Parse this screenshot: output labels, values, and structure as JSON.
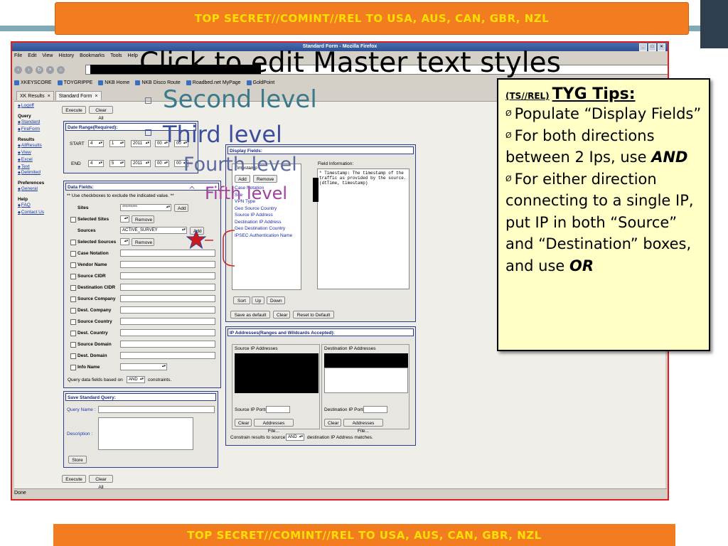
{
  "classification": "TOP SECRET//COMINT//REL TO USA, AUS, CAN, GBR, NZL",
  "colors": {
    "banner_bg": "#f47c20",
    "banner_text": "#ffe000",
    "tips_bg": "#ffffc6",
    "title_teal": "#3a7a8a",
    "accent_purple": "#a040a0"
  },
  "slide": {
    "title": "Click to edit Master text styles",
    "level2": "Second level",
    "level3": "Third level",
    "level4": "Fourth level",
    "level5": "Fifth level"
  },
  "browser": {
    "title": "Standard Form - Mozilla Firefox",
    "menu": [
      "File",
      "Edit",
      "View",
      "History",
      "Bookmarks",
      "Tools",
      "Help"
    ],
    "bookmarks": [
      "XKEYSCORE",
      "TOYGRIPPE",
      "NKB Home",
      "NKB Disco Route",
      "Roadbed.net MyPage",
      "GoldPoint"
    ],
    "tabs": [
      "XK Results",
      "Standard Form"
    ],
    "status": "Done"
  },
  "sidebar": {
    "logoff": "Logoff",
    "query_head": "Query",
    "query_items": [
      "Standard",
      "FireForm"
    ],
    "results_head": "Results",
    "results_items": [
      "AllResults",
      "View",
      "Excel",
      "Text",
      "Delimited"
    ],
    "prefs_head": "Preferences",
    "prefs_items": [
      "General"
    ],
    "help_head": "Help",
    "help_items": [
      "FAQ",
      "Contact Us"
    ]
  },
  "form": {
    "execute": "Execute",
    "clear_all": "Clear All",
    "date_range": {
      "title": "Date Range(Required):",
      "start_label": "START",
      "start": [
        "4",
        "1",
        "2011",
        "00",
        "00"
      ],
      "end_label": "END",
      "end": [
        "4",
        "5",
        "2011",
        "00",
        "00"
      ]
    },
    "data_fields": {
      "title": "Data Fields:",
      "hint": "** Use checkboxes to exclude the indicated value. **",
      "rows": [
        "Sites",
        "Selected Sites",
        "Sources",
        "Selected Sources",
        "Case Notation",
        "Vendor Name",
        "Source CIDR",
        "Destination CIDR",
        "Source Company",
        "Dest. Company",
        "Source Country",
        "Dest. Country",
        "Source Domain",
        "Dest. Domain",
        "Info Name"
      ],
      "sites_value": "*********",
      "sources_value": "ACTIVE_SURVEY",
      "add": "Add",
      "remove": "Remove",
      "query_fields_prefix": "Query data fields based on",
      "and_value": "AND",
      "query_fields_suffix": "constraints."
    },
    "save_query": {
      "title": "Save Standard Query:",
      "name_label": "Query Name :",
      "desc_label": "Description :",
      "store": "Store"
    },
    "display_fields": {
      "title": "Display Fields:",
      "selected": "Timestamp",
      "add": "Add",
      "remove": "Remove",
      "list": [
        "Case Notation",
        "Site",
        "VPN Type",
        "Geo Source Country",
        "Source IP Address",
        "Destination IP Address",
        "Geo Destination Country",
        "IPSEC Authentication Name"
      ],
      "field_info_label": "Field Information:",
      "field_info_text": "* Timestamp: The timestamp of the traffic as provided by the source. (dtTime, timestamp)",
      "sort": "Sort",
      "up": "Up",
      "down": "Down",
      "save_default": "Save as default",
      "clear": "Clear",
      "reset_default": "Reset to Default"
    },
    "ip_addresses": {
      "title": "IP Addresses(Ranges and Wildcards Accepted):",
      "source_label": "Source IP Addresses",
      "dest_label": "Destination IP Addresses",
      "source_ports": "Source IP Ports",
      "dest_ports": "Destination IP Ports",
      "clear": "Clear",
      "addresses_file": "Addresses File...",
      "constrain_prefix": "Constrain results to source",
      "and_value": "AND",
      "constrain_suffix": "destination IP Address matches."
    }
  },
  "tips": {
    "classification": "(TS//REL)",
    "title": "TYG Tips:",
    "tip1": "Populate “Display Fields”",
    "tip2_a": "For both directions between 2 Ips, use",
    "tip2_b": "AND",
    "tip3_a": "For either direction connecting to a single IP, put IP in both “Source” and “Destination” boxes, and use",
    "tip3_b": "OR"
  }
}
